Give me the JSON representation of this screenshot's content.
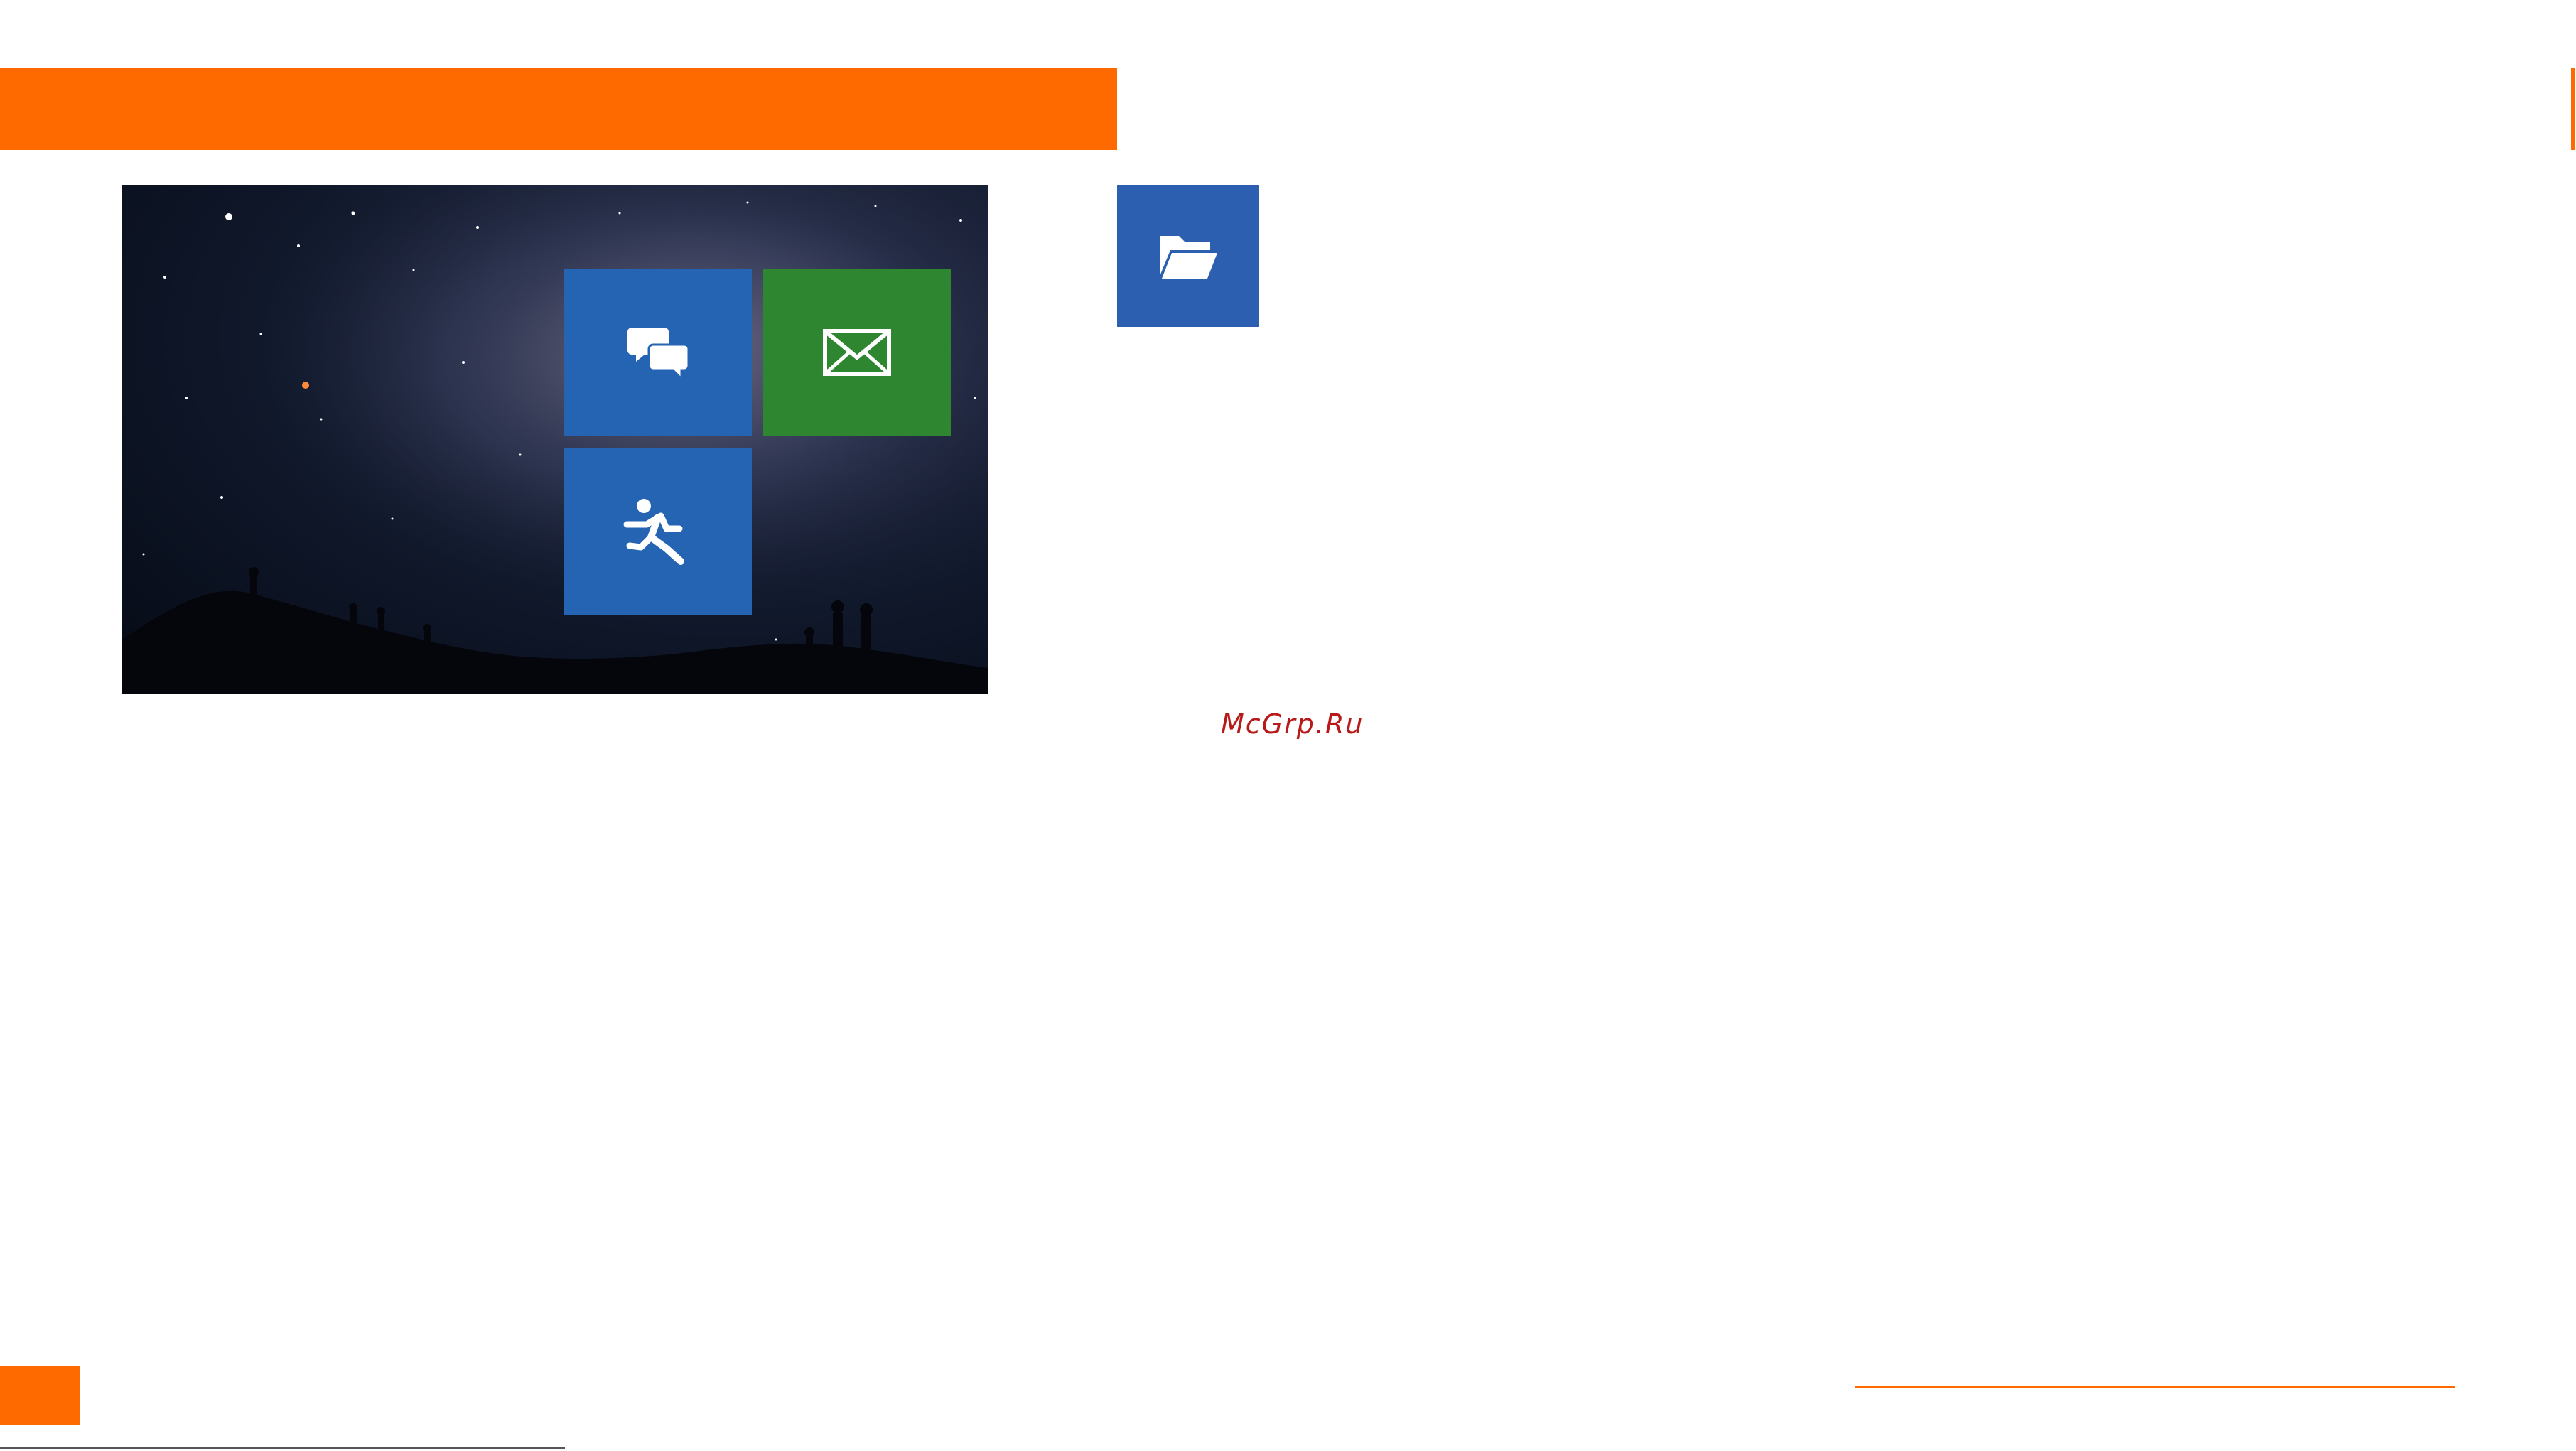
{
  "colors": {
    "accent": "#ff6a00",
    "tile_blue": "#2563b3",
    "tile_green": "#2e8631",
    "tile_folder": "#2d5fb0",
    "watermark": "#b81a1a"
  },
  "tiles": [
    {
      "icon": "chat-bubbles-icon"
    },
    {
      "icon": "envelope-icon"
    },
    {
      "icon": "running-person-icon"
    },
    {
      "icon": "open-folder-icon"
    }
  ],
  "watermark": {
    "text": "McGrp.Ru"
  }
}
